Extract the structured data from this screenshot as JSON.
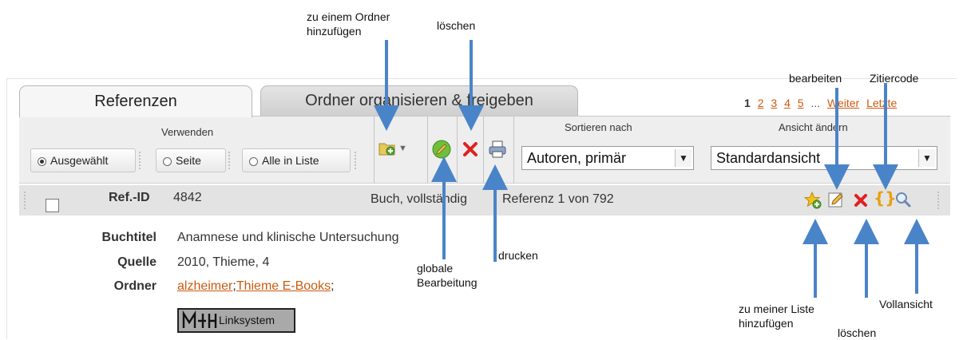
{
  "tabs": [
    {
      "label": "Referenzen",
      "active": true
    },
    {
      "label": "Ordner organisieren & freigeben",
      "active": false
    }
  ],
  "pagination": {
    "current": "1",
    "pages": [
      "2",
      "3",
      "4",
      "5"
    ],
    "ellipsis": "...",
    "next": "Weiter",
    "last": "Letzte"
  },
  "toolbar": {
    "verwenden_label": "Verwenden",
    "options": [
      {
        "label": "Ausgewählt",
        "selected": true
      },
      {
        "label": "Seite",
        "selected": false
      },
      {
        "label": "Alle in Liste",
        "selected": false
      }
    ],
    "sort_label": "Sortieren nach",
    "sort_value": "Autoren, primär",
    "view_label": "Ansicht ändern",
    "view_value": "Standardansicht",
    "icons": [
      "folder-add-icon",
      "dropdown-arrow-icon",
      "global-edit-icon",
      "delete-icon",
      "print-icon"
    ]
  },
  "record": {
    "id_label": "Ref.-ID",
    "id_value": "4842",
    "type_text": "Buch, vollständig",
    "position_text": "Referenz 1 von 792",
    "icons": [
      "star-add-icon",
      "edit-icon",
      "delete-icon",
      "cite-code-icon",
      "full-view-icon"
    ],
    "fields": [
      {
        "label": "Buchtitel",
        "value": "Anamnese und klinische Untersuchung"
      },
      {
        "label": "Quelle",
        "value": "2010, Thieme, 4"
      }
    ],
    "folder_label": "Ordner",
    "folders": [
      "alzheimer",
      "Thieme E-Books"
    ],
    "logo_text": "Linksystem"
  },
  "annotations": {
    "add_folder": [
      "zu einem  Ordner",
      "hinzufügen"
    ],
    "delete_top": "löschen",
    "edit": "bearbeiten",
    "cite": "Zitiercode",
    "global_edit": [
      "globale",
      "Bearbeitung"
    ],
    "print": "drucken",
    "my_list": [
      "zu meiner Liste",
      "hinzufügen"
    ],
    "delete_bottom": "löschen",
    "full_view": "Vollansicht"
  },
  "colors": {
    "arrow": "#4a84c8",
    "link": "#cc5a10",
    "toolbar_bg": "#eeeeee",
    "record_bar_bg": "#e3e3e3"
  }
}
